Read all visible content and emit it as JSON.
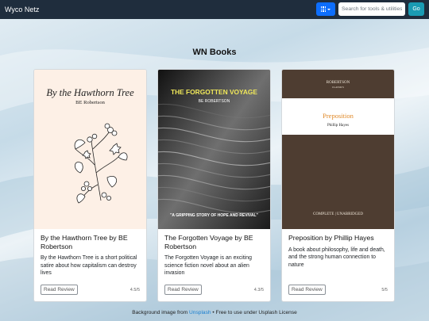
{
  "navbar": {
    "brand": "Wyco Netz",
    "search_placeholder": "Search for tools & utilities",
    "go_label": "Go",
    "apps_icon": "grid-icon"
  },
  "page": {
    "title": "WN Books"
  },
  "books": [
    {
      "cover_title": "By the Hawthorn Tree",
      "cover_author": "BE Robertson",
      "title": "By the Hawthorn Tree by BE Robertson",
      "description": "By the Hawthorn Tree is a short political satire about how capitalism can destroy lives",
      "button": "Read Review",
      "rating": "4.5/5"
    },
    {
      "cover_title": "THE FORGOTTEN VOYAGE",
      "cover_author": "BE ROBERTSON",
      "cover_tagline": "\"A GRIPPING STORY OF HOPE AND REVIVAL\"",
      "title": "The Forgotten Voyage by BE Robertson",
      "description": "The Forgotten Voyage is an exciting science fiction novel about an alien invasion",
      "button": "Read Review",
      "rating": "4.3/5"
    },
    {
      "cover_publisher": "ROBERTSON",
      "cover_series": "CLASSICS",
      "cover_title": "Preposition",
      "cover_author": "Phillip Hayes",
      "cover_footer": "COMPLETE | UNABRIDGED",
      "title": "Preposition by Phillip Hayes",
      "description": "A book about philosophy, life and death, and the strong human connection to nature",
      "button": "Read Review",
      "rating": "5/5"
    }
  ],
  "footer": {
    "prefix": "Background image from",
    "link": "Unsplash",
    "suffix": "• Free to use under Usplash License"
  }
}
